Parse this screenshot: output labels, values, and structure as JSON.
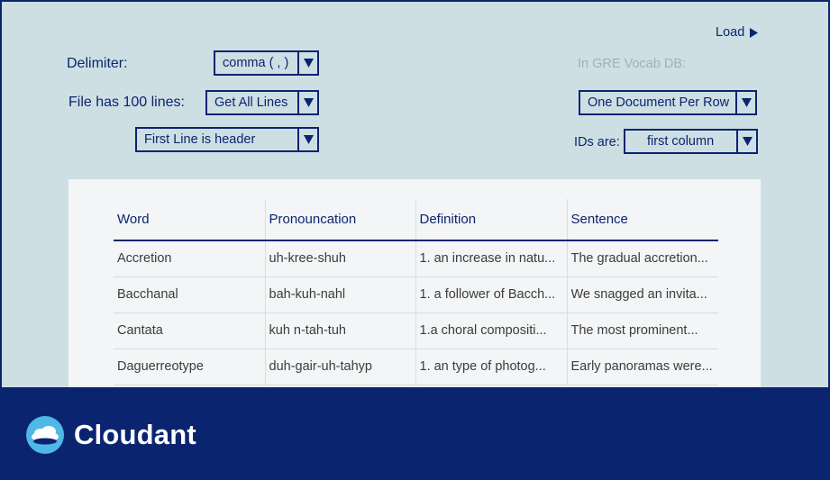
{
  "toolbar": {
    "load_label": "Load"
  },
  "options": {
    "delimiter_label": "Delimiter:",
    "delimiter_value": "comma ( , )",
    "file_lines_label": "File has 100 lines:",
    "lines_value": "Get All Lines",
    "header_value": "First Line is header"
  },
  "destination": {
    "db_label": "In GRE Vocab DB:",
    "mode_value": "One Document Per Row",
    "ids_label": "IDs are:",
    "ids_value": "first column"
  },
  "table": {
    "headers": [
      "Word",
      "Pronouncation",
      "Definition",
      "Sentence"
    ],
    "rows": [
      [
        "Accretion",
        "uh-kree-shuh",
        "1. an increase in natu...",
        "The gradual accretion..."
      ],
      [
        "Bacchanal",
        "bah-kuh-nahl",
        "1. a follower of Bacch...",
        "We snagged an invita..."
      ],
      [
        "Cantata",
        "kuh n-tah-tuh",
        "1.a choral compositi...",
        "The most prominent..."
      ],
      [
        "Daguerreotype",
        "duh-gair-uh-tahyp",
        "1. an type of photog...",
        "Early panoramas were..."
      ]
    ]
  },
  "footer": {
    "brand": "Cloudant"
  },
  "icons": {
    "dropdown": "chevron-down-icon",
    "load": "play-triangle-icon",
    "logo": "cloud-logo-icon"
  },
  "colors": {
    "navy": "#0b2470",
    "background": "#cddfe3",
    "panel": "#f3f5f6",
    "muted": "#9fb2b8",
    "logo_blue": "#4fb8e6"
  }
}
